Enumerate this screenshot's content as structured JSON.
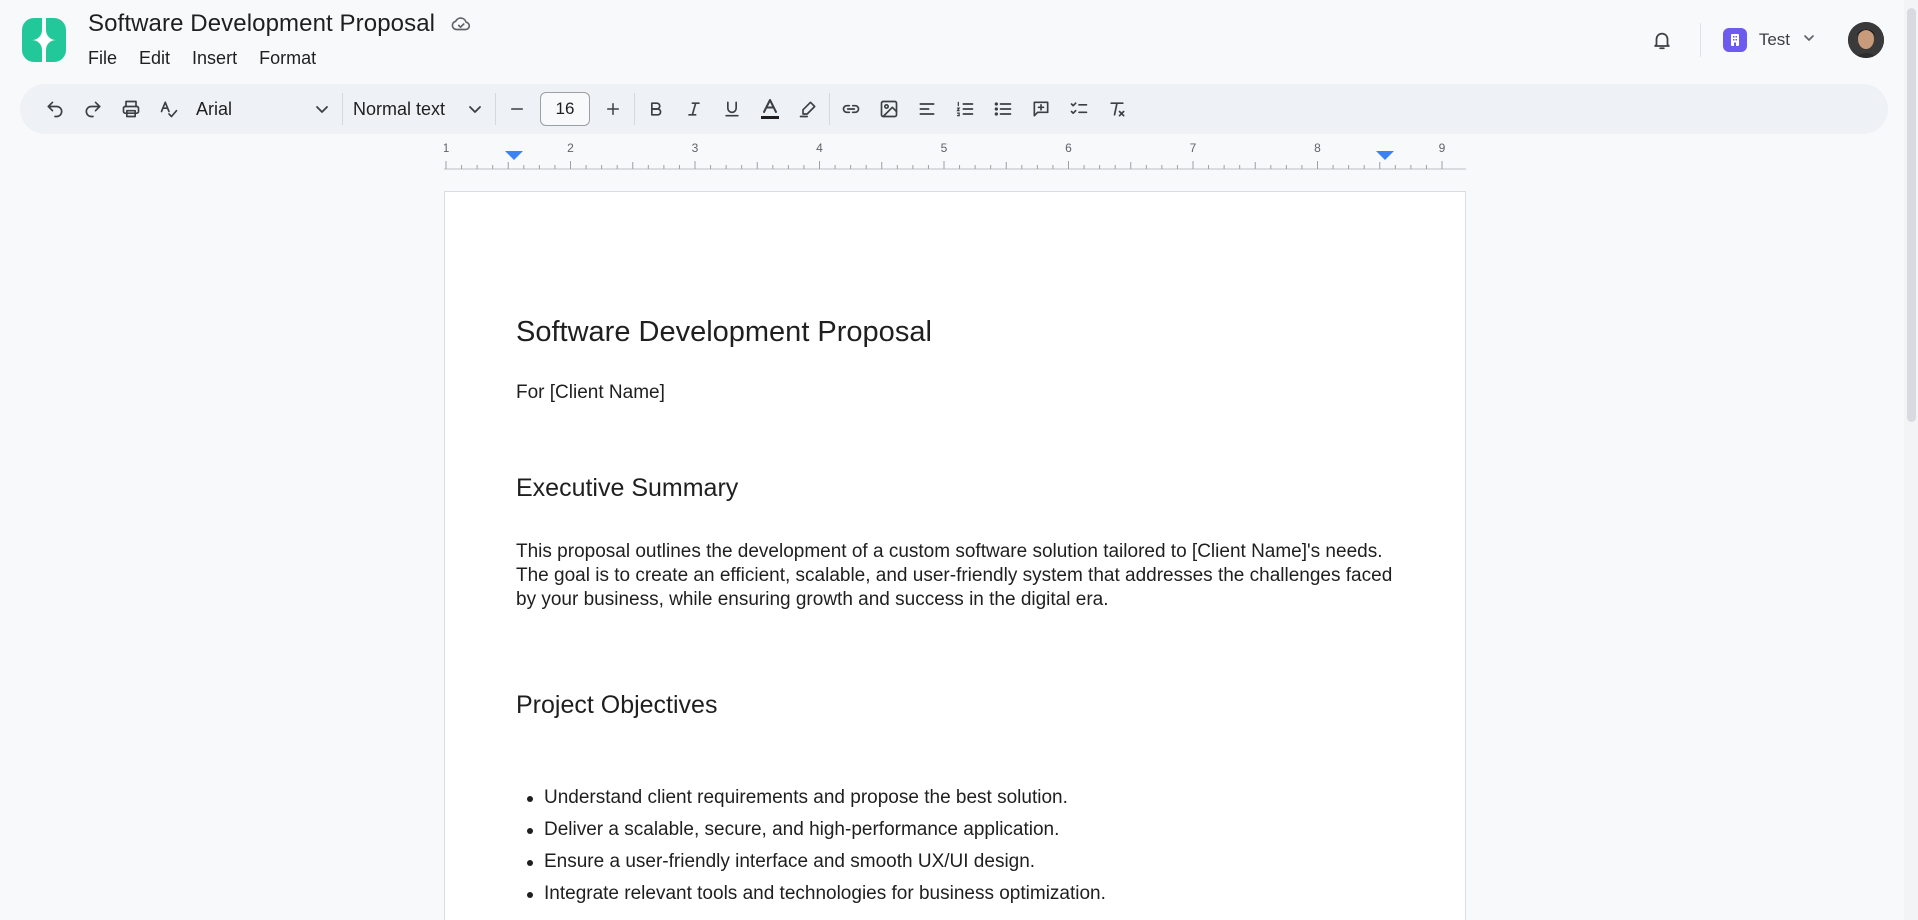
{
  "header": {
    "doc_title": "Software Development Proposal",
    "menu": [
      "File",
      "Edit",
      "Insert",
      "Format"
    ],
    "workspace_name": "Test"
  },
  "toolbar": {
    "font": "Arial",
    "style": "Normal text",
    "font_size": "16"
  },
  "ruler": {
    "labels": [
      "1",
      "2",
      "3",
      "4",
      "5",
      "6",
      "7",
      "8",
      "9"
    ]
  },
  "document": {
    "title": "Software Development Proposal",
    "subtitle": "For [Client Name]",
    "section1_heading": "Executive Summary",
    "section1_body": "This proposal outlines the development of a custom software solution tailored to [Client Name]'s needs. The goal is to create an efficient, scalable, and user-friendly system that addresses the challenges faced by your business, while ensuring growth and success in the digital era.",
    "section2_heading": "Project Objectives",
    "objectives": [
      "Understand client requirements and propose the best solution.",
      "Deliver a scalable, secure, and high-performance application.",
      "Ensure a user-friendly interface and smooth UX/UI design.",
      "Integrate relevant tools and technologies for business optimization."
    ]
  },
  "colors": {
    "brand": "#22c79a",
    "workspace_badge": "#6d5bf0",
    "ruler_marker": "#3b82f6"
  }
}
